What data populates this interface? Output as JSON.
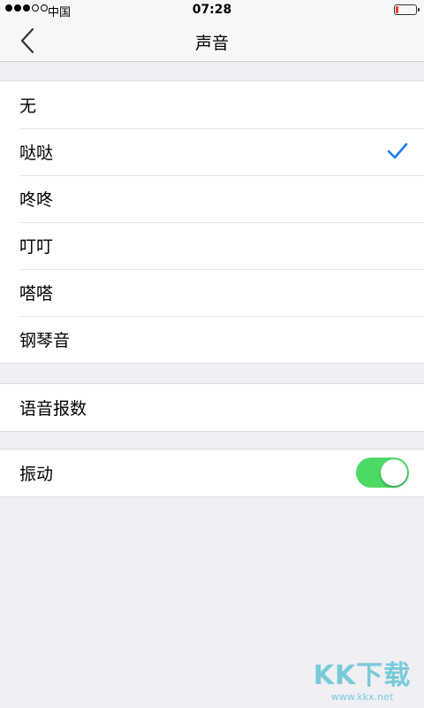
{
  "status_bar": {
    "carrier": "中国",
    "time": "07:28",
    "signal_filled": 3,
    "signal_total": 5,
    "battery_level_fraction": 0.12,
    "battery_color": "#ff3b30"
  },
  "nav": {
    "title": "声音",
    "back_icon": "chevron-left-icon"
  },
  "sound_options": {
    "items": [
      {
        "label": "无",
        "selected": false
      },
      {
        "label": "哒哒",
        "selected": true
      },
      {
        "label": "咚咚",
        "selected": false
      },
      {
        "label": "叮叮",
        "selected": false
      },
      {
        "label": "嗒嗒",
        "selected": false
      },
      {
        "label": "钢琴音",
        "selected": false
      }
    ],
    "check_icon": "checkmark-icon",
    "check_color": "#1a7cf0"
  },
  "voice": {
    "label": "语音报数"
  },
  "vibration": {
    "label": "振动",
    "enabled": true,
    "toggle_color": "#4cd964"
  },
  "watermark": {
    "logo": "KK下载",
    "url": "www.kkx.net"
  },
  "colors": {
    "background": "#efeff4",
    "bar": "#f7f7f7"
  }
}
